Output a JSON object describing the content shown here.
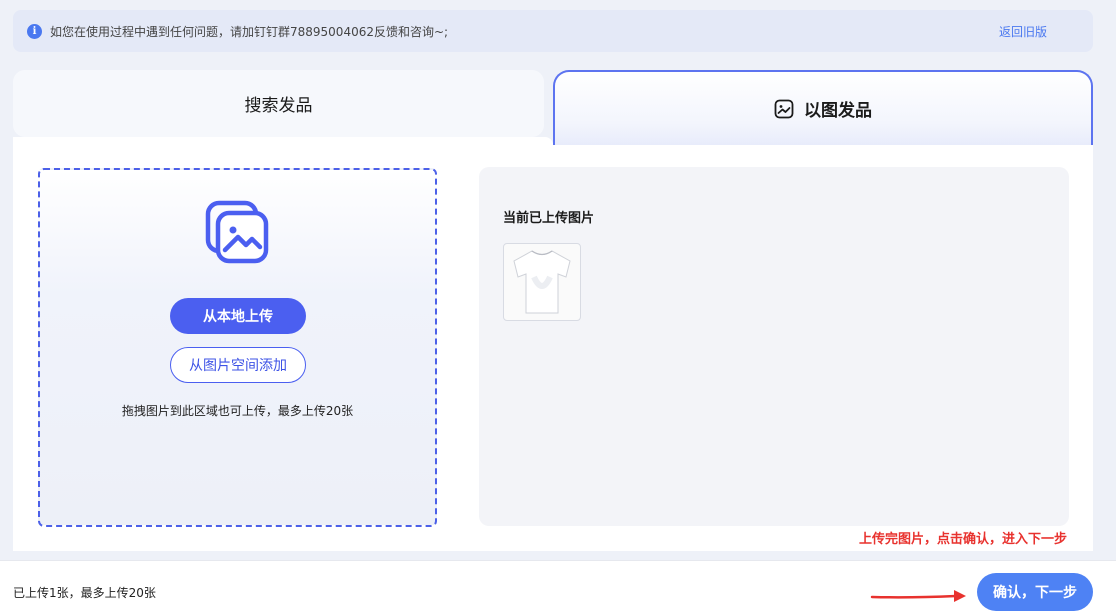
{
  "notice": {
    "text": "如您在使用过程中遇到任何问题，请加钉钉群78895004062反馈和咨询~;",
    "back_link": "返回旧版",
    "icon": "info-icon"
  },
  "tabs": [
    {
      "label": "搜索发品",
      "active": false
    },
    {
      "label": "以图发品",
      "active": true,
      "icon": "image-smile-icon"
    }
  ],
  "upload": {
    "icon": "image-stack-icon",
    "local_button": "从本地上传",
    "space_button": "从图片空间添加",
    "hint": "拖拽图片到此区域也可上传，最多上传20张"
  },
  "uploaded_panel": {
    "title": "当前已上传图片",
    "images": [
      {
        "icon": "tshirt-thumbnail"
      }
    ]
  },
  "guide": "上传完图片，点击确认，进入下一步",
  "footer": {
    "count_text": "已上传1张，最多上传20张",
    "next_button": "确认，下一步"
  },
  "colors": {
    "accent": "#4b5ff0",
    "next_button": "#4e82f4",
    "guide_red": "#e8322e"
  }
}
